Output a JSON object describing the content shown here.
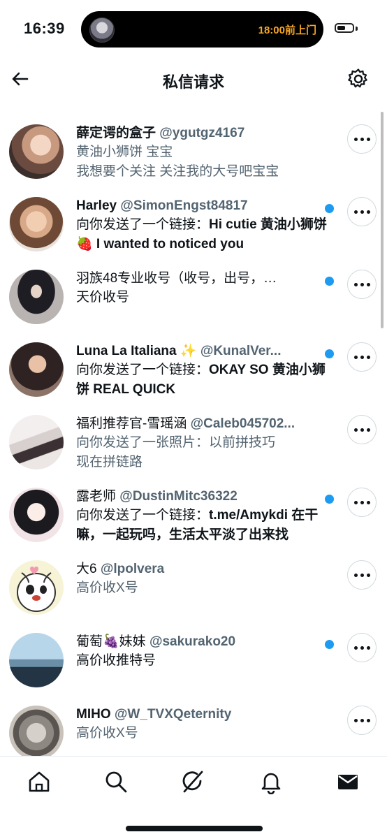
{
  "status_bar": {
    "time": "16:39",
    "island_text": "18:00前上门",
    "battery_level": 0.55
  },
  "header": {
    "title": "私信请求"
  },
  "accent_color": "#1d9bf0",
  "rows": [
    {
      "name": "薛定谔的盒子",
      "handle": "@ygutgz4167",
      "message": "黄油小狮饼 宝宝\n我想要个关注 关注我的大号吧宝宝",
      "unread": false
    },
    {
      "name": "Harley",
      "handle": "@SimonEngst84817",
      "message_prefix": "向你发送了一个链接：",
      "message": "Hi cutie 黄油小狮饼 🍓 I wanted to noticed you",
      "unread": true
    },
    {
      "name": "羽族48专业收号（收号，出号，…",
      "handle": "",
      "message": "天价收号",
      "unread": true
    },
    {
      "name": "Luna La Italiana ✨",
      "handle": "@KunalVer...",
      "message_prefix": "向你发送了一个链接：",
      "message": "OKAY SO 黄油小狮饼 REAL QUICK",
      "unread": true
    },
    {
      "name": "福利推荐官-雪瑶涵",
      "handle": "@Caleb045702...",
      "message": "向你发送了一张照片：以前拼技巧\n现在拼链路",
      "unread": false
    },
    {
      "name": "露老师",
      "handle": "@DustinMitc36322",
      "message_prefix": "向你发送了一个链接：",
      "message": "t.me/Amykdi 在干嘛，一起玩吗，生活太平淡了出来找",
      "unread": true
    },
    {
      "name": "大6",
      "handle": "@lpolvera",
      "message": "高价收X号",
      "unread": false
    },
    {
      "name": "葡萄🍇妹妹",
      "handle": "@sakurako20",
      "message": "高价收推特号",
      "unread": true
    },
    {
      "name": "MIHO",
      "handle": "@W_TVXQeternity",
      "message": "高价收X号",
      "unread": false
    }
  ],
  "nav": [
    "home-icon",
    "search-icon",
    "grok-icon",
    "notifications-icon",
    "messages-icon"
  ]
}
